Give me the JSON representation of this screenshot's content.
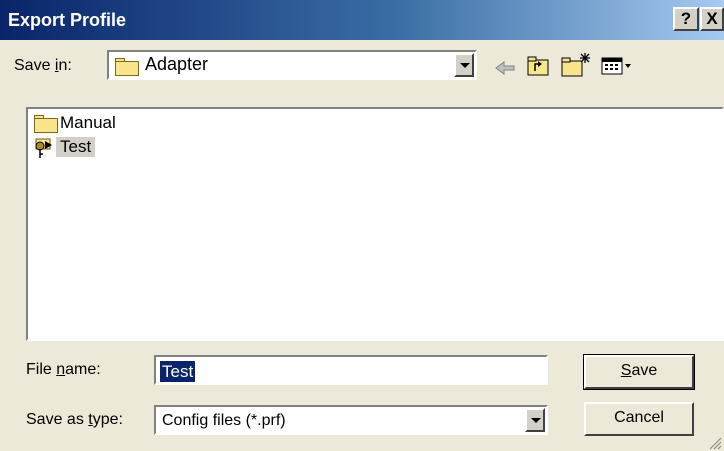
{
  "titlebar": {
    "title": "Export Profile",
    "help": "?",
    "close": "X"
  },
  "save_in": {
    "label_pre": "Save ",
    "label_u": "i",
    "label_post": "n:",
    "folder": "Adapter"
  },
  "toolbar": {
    "back": "back-arrow-icon",
    "up": "up-folder-icon",
    "new": "new-folder-icon",
    "view": "view-menu-icon"
  },
  "files": [
    {
      "name": "Manual",
      "icon": "folder-icon"
    },
    {
      "name": "Test",
      "icon": "profile-key-icon"
    }
  ],
  "file_name": {
    "label_pre": "File ",
    "label_u": "n",
    "label_post": "ame:",
    "value": "Test"
  },
  "save_type": {
    "label_pre": "Save as ",
    "label_u": "t",
    "label_post": "ype:",
    "value": "Config files (*.prf)"
  },
  "buttons": {
    "save_u": "S",
    "save_rest": "ave",
    "cancel": "Cancel"
  },
  "colors": {
    "title_start": "#0a246a",
    "title_end": "#a6caf0",
    "face": "#ece9d8",
    "selection": "#0a246a"
  }
}
